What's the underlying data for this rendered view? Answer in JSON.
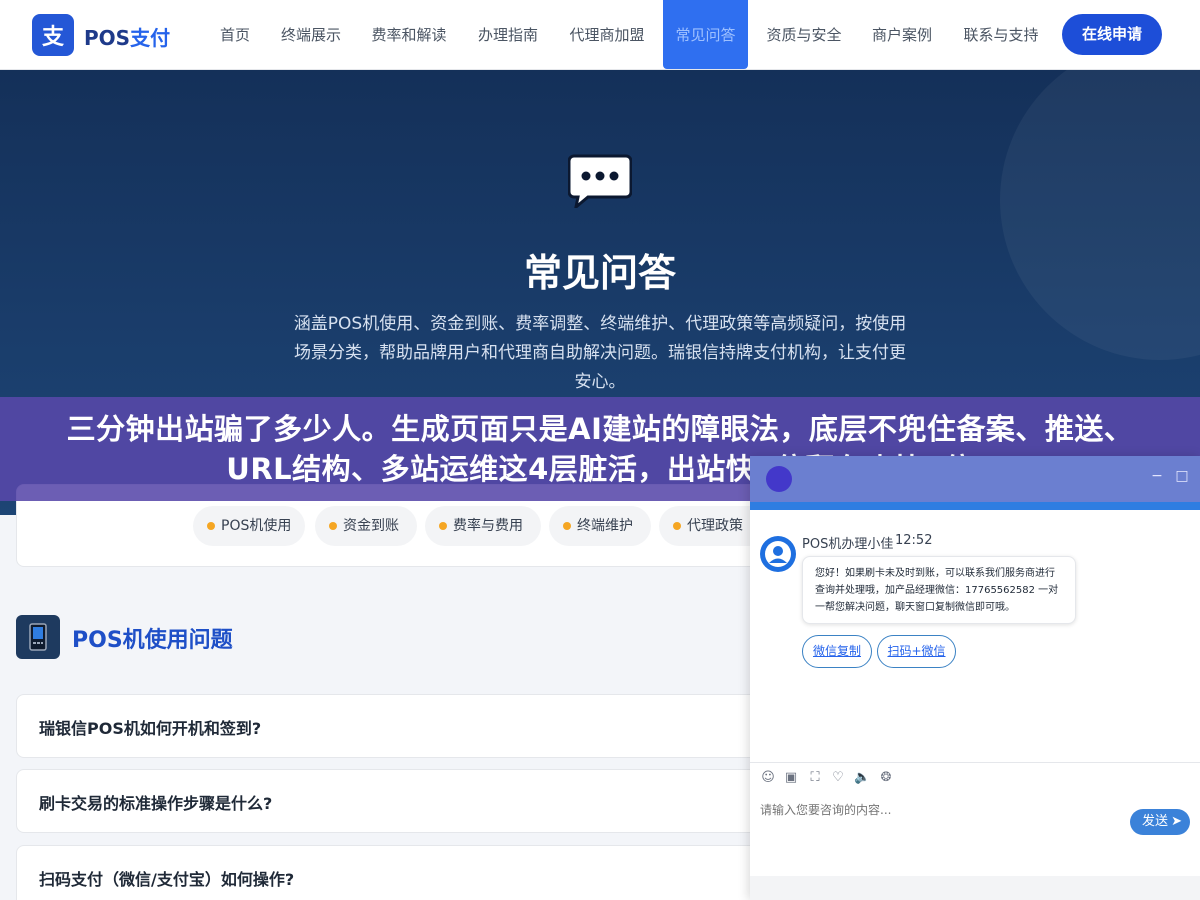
{
  "header": {
    "logo_char": "支",
    "logo_pos": "POS",
    "logo_suffix": "支付",
    "nav": [
      {
        "label": "首页"
      },
      {
        "label": "终端展示"
      },
      {
        "label": "费率和解读"
      },
      {
        "label": "办理指南"
      },
      {
        "label": "代理商加盟"
      },
      {
        "label": "常见问答"
      },
      {
        "label": "资质与安全"
      },
      {
        "label": "商户案例"
      },
      {
        "label": "联系与支持"
      }
    ],
    "active_nav": "常见问答",
    "cta": "在线申请"
  },
  "hero": {
    "icon": "chat-dots-icon",
    "title": "常见问答",
    "description": "涵盖POS机使用、资金到账、费率调整、终端维护、代理政策等高频疑问，按使用场景分类，帮助品牌用户和代理商自助解决问题。瑞银信持牌支付机构，让支付更安心。"
  },
  "banner": {
    "text": "三分钟出站骗了多少人。生成页面只是AI建站的障眼法，底层不兜住备案、推送、URL结构、多站运维这4层脏活，出站快3倍翻车也快3倍"
  },
  "categories": [
    {
      "label": "POS机使用"
    },
    {
      "label": "资金到账"
    },
    {
      "label": "费率与费用"
    },
    {
      "label": "终端维护"
    },
    {
      "label": "代理政策"
    }
  ],
  "section": {
    "icon": "pos-terminal-icon",
    "title": "POS机使用问题"
  },
  "faqs": [
    {
      "question": "瑞银信POS机如何开机和签到?"
    },
    {
      "question": "刷卡交易的标准操作步骤是什么?"
    },
    {
      "question": "扫码支付（微信/支付宝）如何操作?"
    }
  ],
  "chat": {
    "agent_name": "POS机办理小佳",
    "time": "12:52",
    "message": "您好！如果刷卡未及时到账，可以联系我们服务商进行查询并处理哦，加产品经理微信：17765562582 一对一帮您解决问题，聊天窗口复制微信即可哦。",
    "quick_replies": [
      {
        "label": "微信复制"
      },
      {
        "label": "扫码+微信"
      }
    ],
    "input_placeholder": "请输入您要咨询的内容...",
    "send_label": "发送",
    "minimize": "−",
    "maximize": "□",
    "tools": [
      {
        "icon": "emoji-icon",
        "glyph": "☺"
      },
      {
        "icon": "image-icon",
        "glyph": "▣"
      },
      {
        "icon": "screenshot-icon",
        "glyph": "⛶"
      },
      {
        "icon": "rating-icon",
        "glyph": "♡"
      },
      {
        "icon": "mute-icon",
        "glyph": "🔈"
      },
      {
        "icon": "wechat-icon",
        "glyph": "❂"
      }
    ]
  },
  "colors": {
    "brand_blue": "#2457d6",
    "hero_bg": "#143059",
    "banner_purple": "#5848aa",
    "accent_orange": "#f5a623",
    "chat_strip": "#2f7de1"
  }
}
